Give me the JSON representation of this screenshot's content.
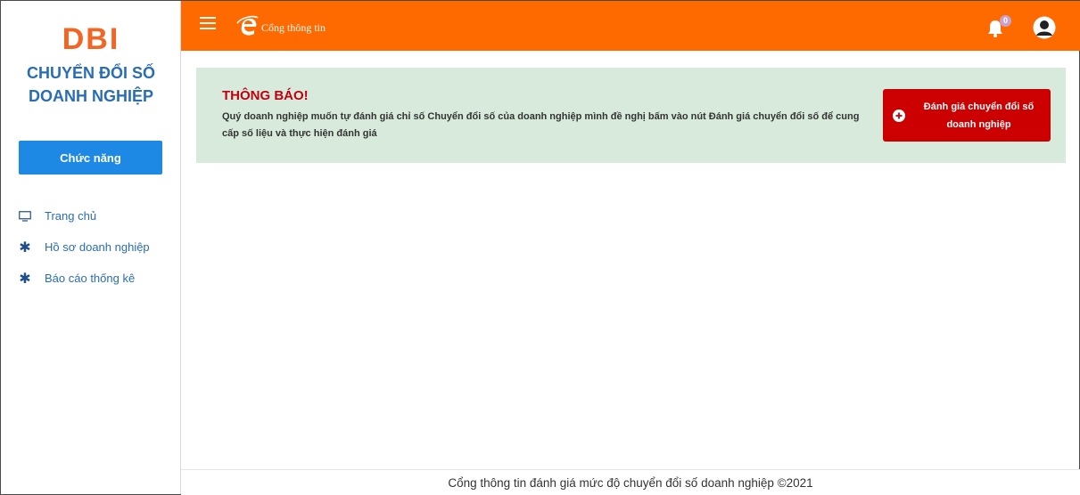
{
  "sidebar": {
    "logo": "DBI",
    "subtitle_line1": "CHUYỂN ĐỔI SỐ",
    "subtitle_line2": "DOANH NGHIỆP",
    "function_button": "Chức năng",
    "items": [
      {
        "label": "Trang chủ",
        "icon": "monitor-icon"
      },
      {
        "label": "Hồ sơ doanh nghiệp",
        "icon": "asterisk-icon"
      },
      {
        "label": "Báo cáo thống kê",
        "icon": "asterisk-icon"
      }
    ]
  },
  "header": {
    "brand_text": "Cổng thông tin",
    "notification_count": "0",
    "colors": {
      "bar": "#ff6a00"
    }
  },
  "notice": {
    "title": "THÔNG BÁO!",
    "text": "Quý doanh nghiệp muốn tự đánh giá chỉ số Chuyển đổi số của doanh nghiệp mình đề nghị bấm vào nút Đánh giá chuyển đổi số để cung cấp số liệu và thực hiện đánh giá",
    "button_label": "Đánh giá chuyển đổi số doanh nghiệp"
  },
  "footer": {
    "text": "Cổng thông tin đánh giá mức độ chuyển đổi số doanh nghiệp ©2021"
  }
}
